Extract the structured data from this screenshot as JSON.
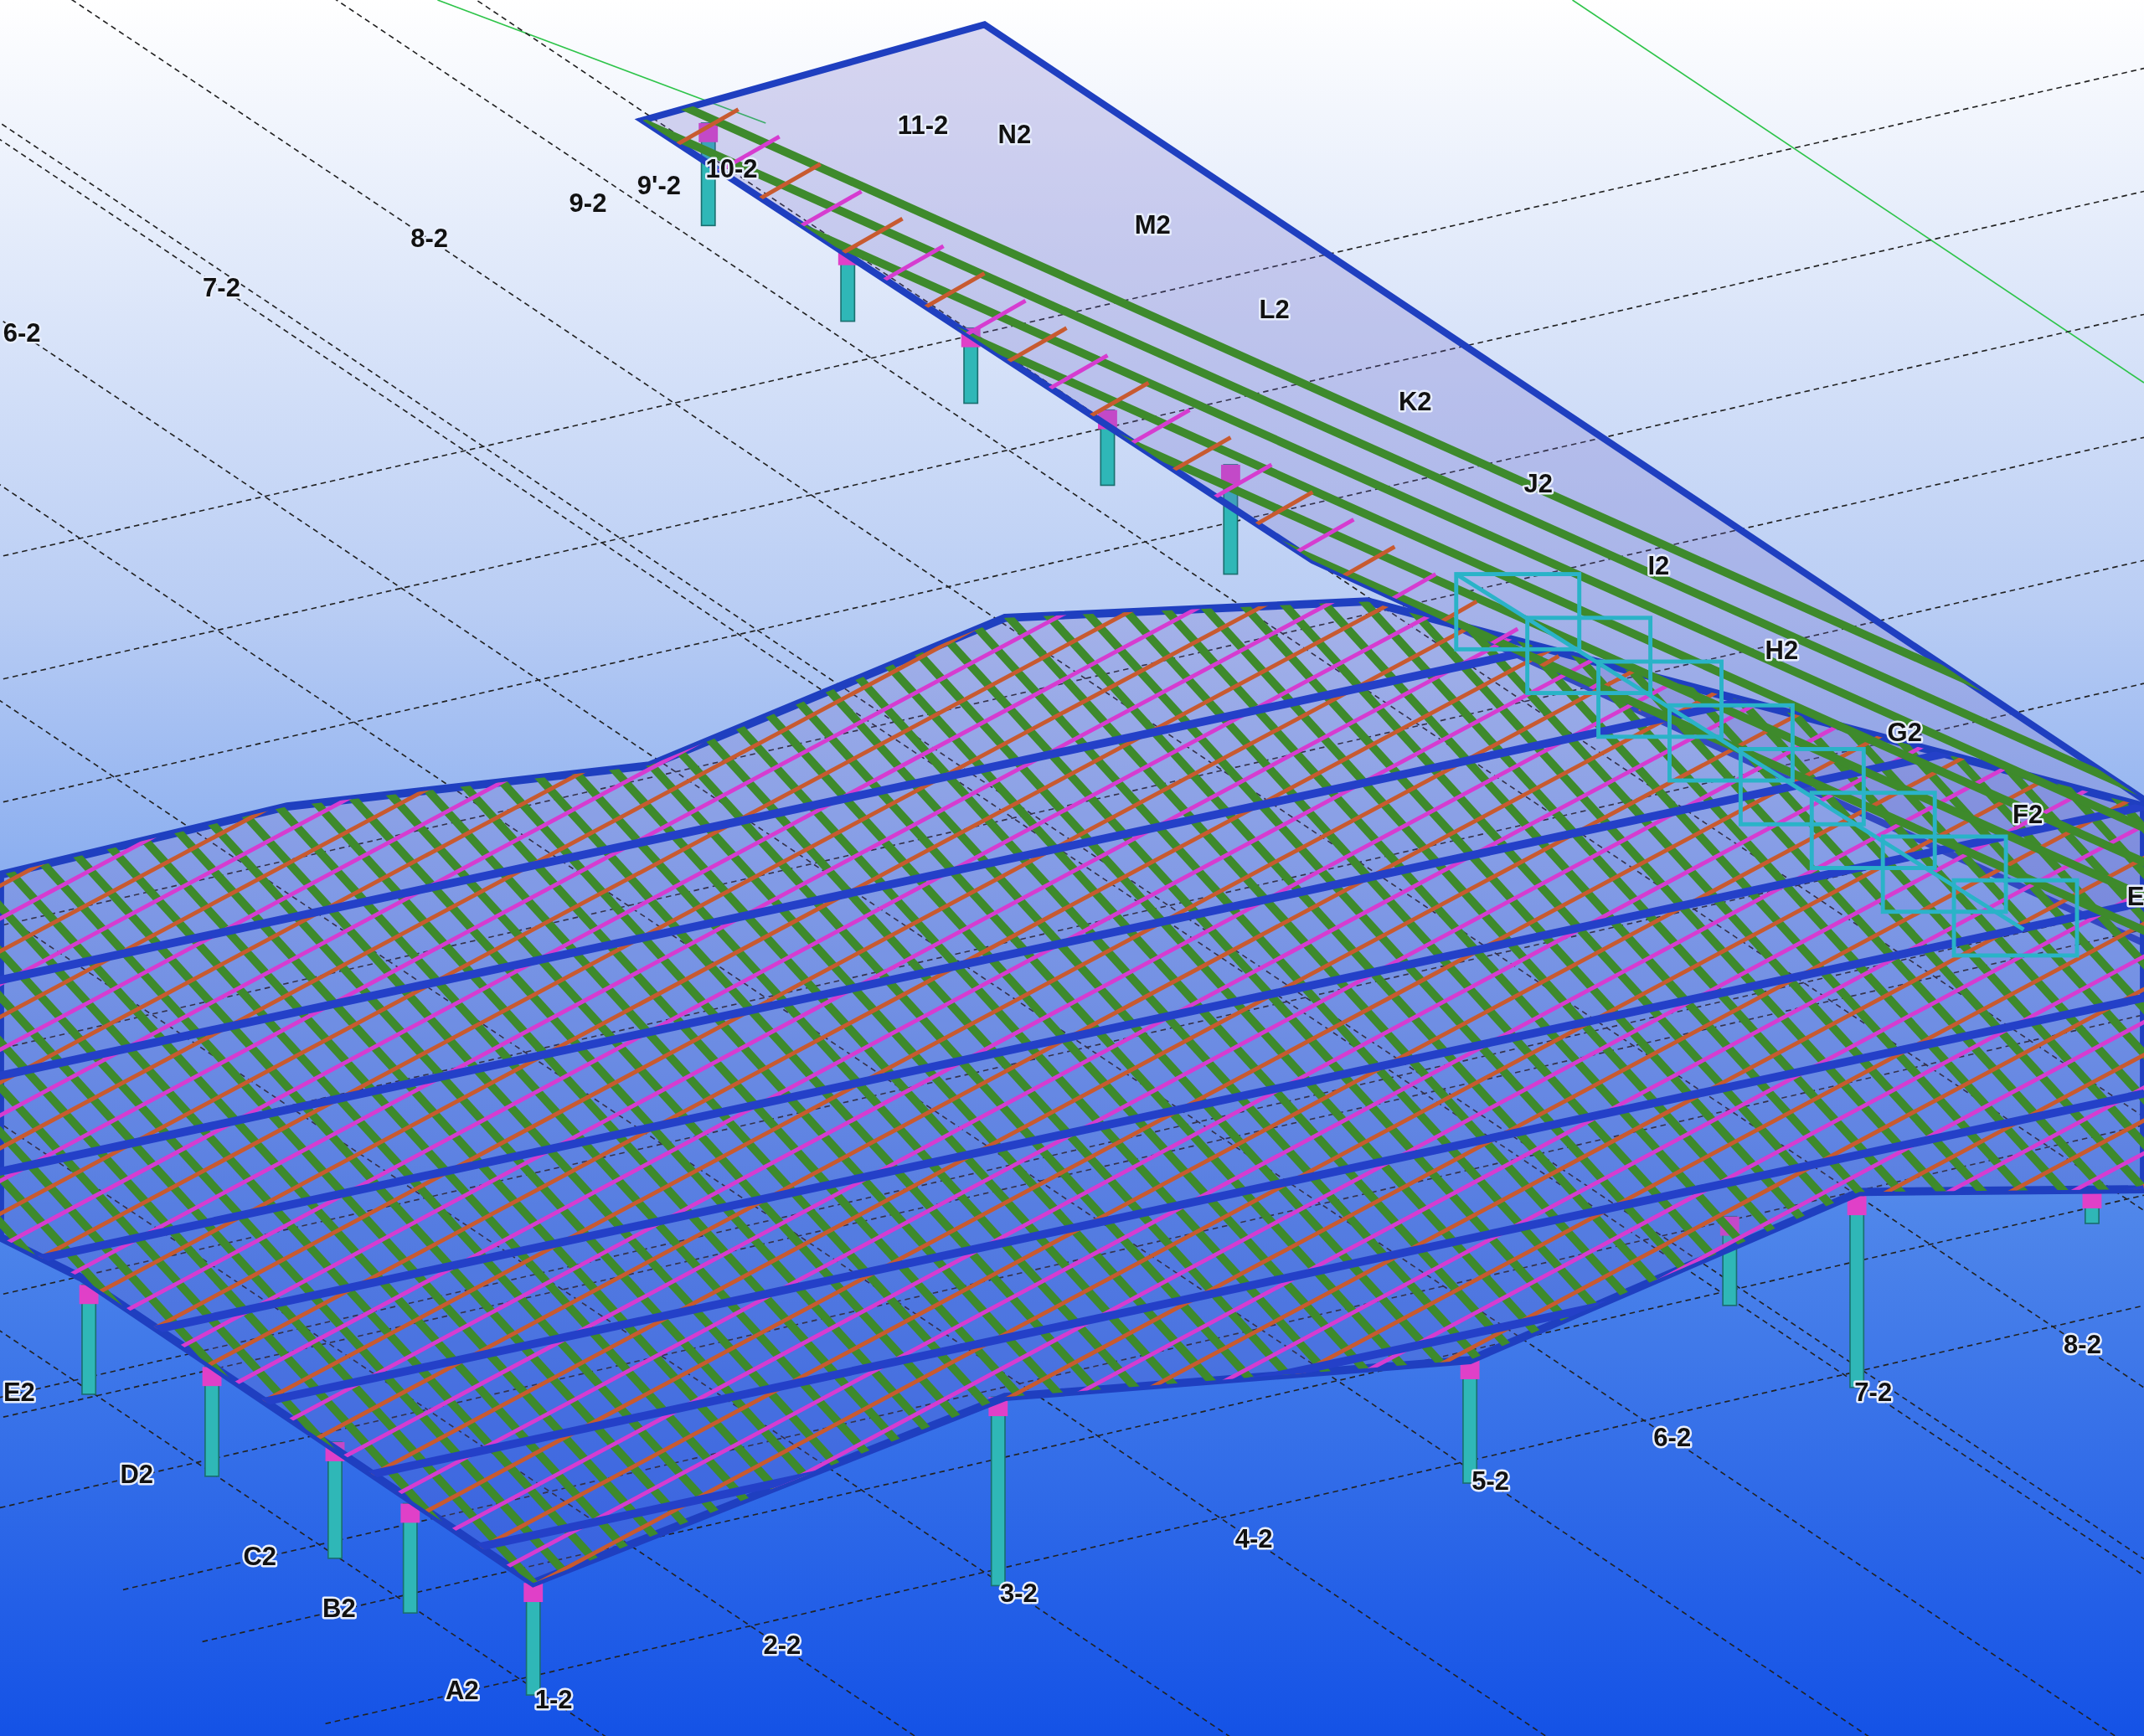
{
  "viewport": {
    "grid_labels": [
      {
        "text": "11-2"
      },
      {
        "text": "N2"
      },
      {
        "text": "10-2"
      },
      {
        "text": "9'-2"
      },
      {
        "text": "9-2"
      },
      {
        "text": "8-2"
      },
      {
        "text": "7-2"
      },
      {
        "text": "6-2"
      },
      {
        "text": "M2"
      },
      {
        "text": "L2"
      },
      {
        "text": "K2"
      },
      {
        "text": "J2"
      },
      {
        "text": "I2"
      },
      {
        "text": "H2"
      },
      {
        "text": "G2"
      },
      {
        "text": "F2"
      },
      {
        "text": "E"
      },
      {
        "text": "E2"
      },
      {
        "text": "D2"
      },
      {
        "text": "C2"
      },
      {
        "text": "B2"
      },
      {
        "text": "A2"
      },
      {
        "text": "1-2"
      },
      {
        "text": "2-2"
      },
      {
        "text": "3-2"
      },
      {
        "text": "4-2"
      },
      {
        "text": "5-2"
      },
      {
        "text": "6-2"
      },
      {
        "text": "7-2"
      },
      {
        "text": "8-2"
      }
    ]
  }
}
